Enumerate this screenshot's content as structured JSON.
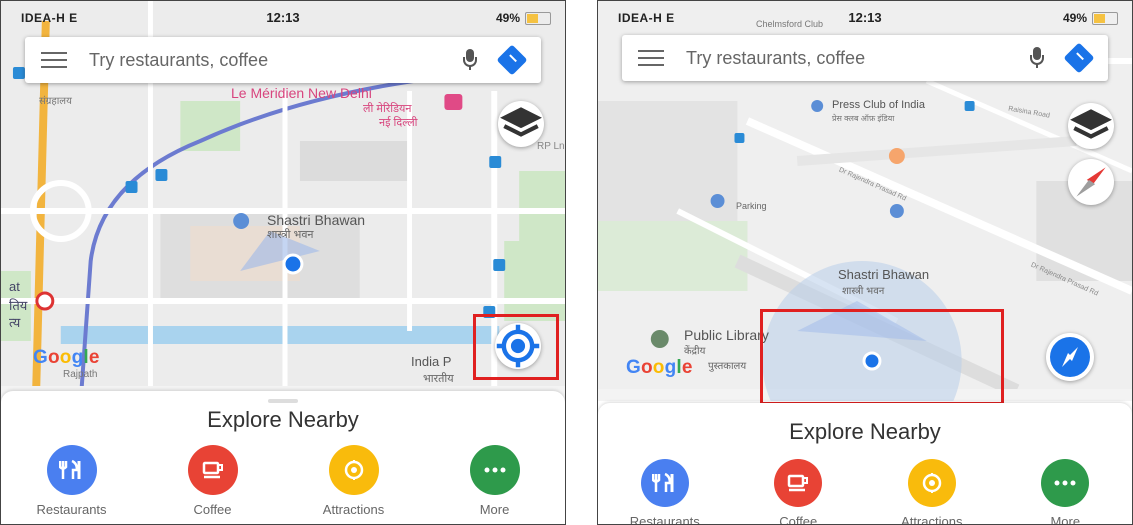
{
  "colors": {
    "restaurants": "#4a7ff0",
    "coffee": "#e84335",
    "attractions": "#f9bb0c",
    "more": "#2e9a4b",
    "accent": "#1a73e8",
    "highlight": "#e02020"
  },
  "left": {
    "status": {
      "carrier": "IDEA-H  E",
      "time": "12:13",
      "battery": "49%"
    },
    "search": {
      "placeholder": "Try restaurants, coffee"
    },
    "map": {
      "poi_le_meridien": "Le Méridien New Delhi",
      "poi_le_meridien_hi": "ली मेरिडियन",
      "poi_le_meridien_hi2": "नई दिल्ली",
      "poi_shastri": "Shastri Bhawan",
      "poi_shastri_hi": "शास्त्री भवन",
      "poi_india": "India P",
      "poi_india_hi": "भारतीय",
      "road_rp": "RP Ln",
      "poi_rajpath": "Rajpath",
      "edge_at": "at",
      "edge_tiy": "तिय",
      "edge_tsy": "त्य",
      "top_left_hi": "संग्रहालय",
      "google": [
        "G",
        "o",
        "o",
        "g",
        "l",
        "e"
      ]
    },
    "sheet": {
      "title": "Explore Nearby"
    },
    "icons": {
      "recenter": "my-location-icon",
      "layers": "layers-icon"
    }
  },
  "right": {
    "status": {
      "carrier": "IDEA-H  E",
      "time": "12:13",
      "battery": "49%",
      "extra": "Chelmsford Club"
    },
    "search": {
      "placeholder": "Try restaurants, coffee"
    },
    "map": {
      "poi_press": "Press Club of India",
      "poi_press_hi": "प्रेस क्लब ऑफ़ इंडिया",
      "poi_parking": "Parking",
      "poi_shastri": "Shastri Bhawan",
      "poi_shastri_hi": "शास्त्री भवन",
      "poi_library": "Public Library",
      "poi_library_hi": "केंद्रीय",
      "poi_library_hi2": "पुस्तकालय",
      "road_raisina": "Raisina Road",
      "road_rp1": "Dr Rajendra Prasad Rd",
      "road_rp2": "Dr Rajendra Prasad Rd",
      "google": [
        "G",
        "o",
        "o",
        "g",
        "l",
        "e"
      ]
    },
    "sheet": {
      "title": "Explore Nearby"
    },
    "icons": {
      "compass": "compass-icon",
      "layers": "layers-icon",
      "direction": "navigation-icon"
    }
  },
  "categories": [
    {
      "label": "Restaurants",
      "icon": "restaurant-icon"
    },
    {
      "label": "Coffee",
      "icon": "coffee-icon"
    },
    {
      "label": "Attractions",
      "icon": "attractions-icon"
    },
    {
      "label": "More",
      "icon": "more-icon"
    }
  ]
}
